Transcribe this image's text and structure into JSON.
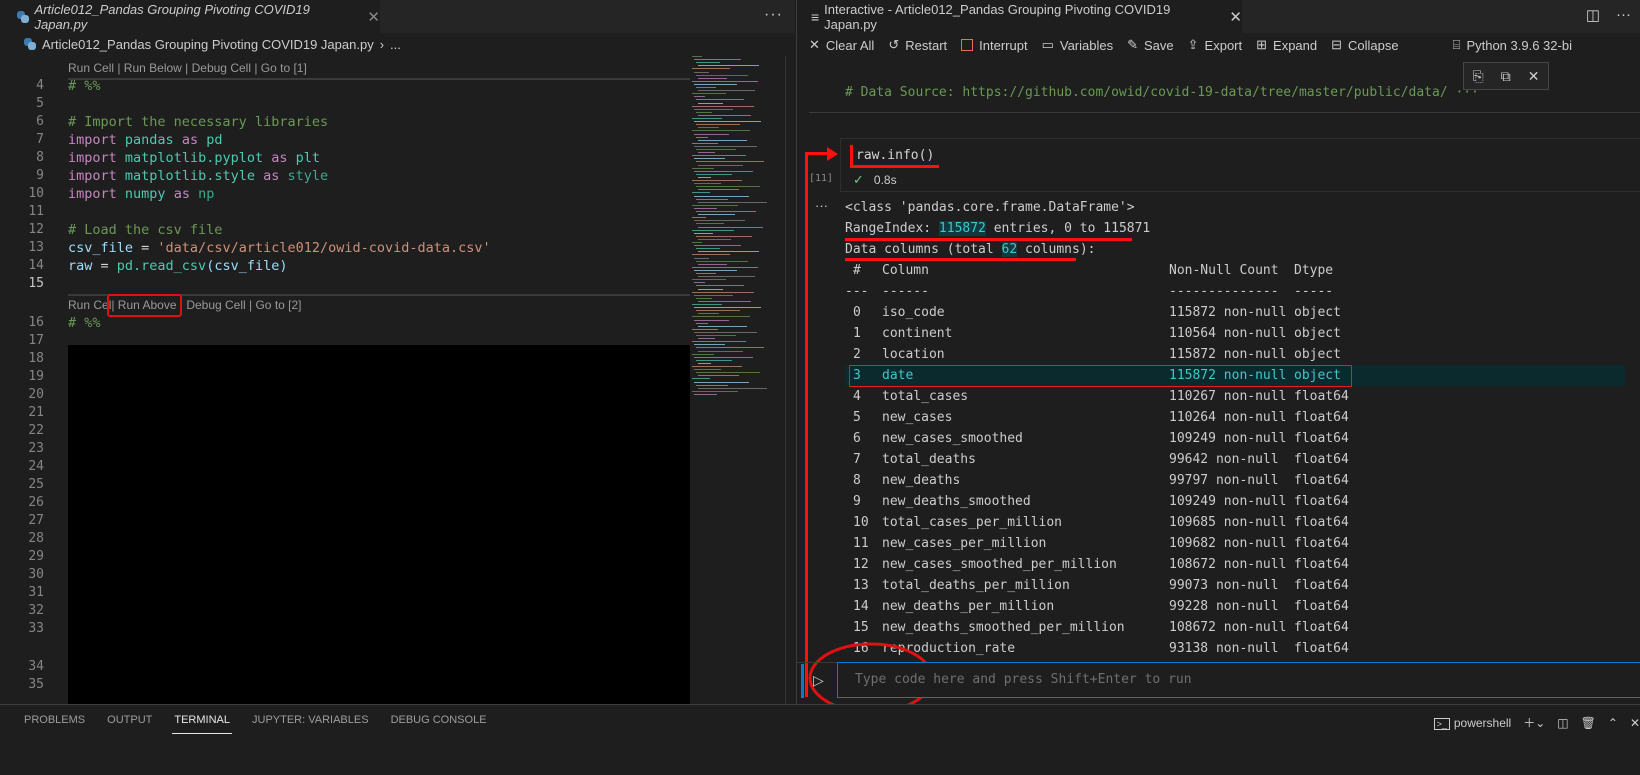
{
  "left_editor": {
    "tab_label": "Article012_Pandas Grouping Pivoting COVID19 Japan.py",
    "tab_close": "✕",
    "more": "···",
    "breadcrumb": "Article012_Pandas Grouping Pivoting COVID19 Japan.py",
    "breadcrumb_sep": "›",
    "breadcrumb_more": "...",
    "codelens_1": "Run Cell | Run Below | Debug Cell | Go to [1]",
    "codelens_2_part1": "Run Cel",
    "codelens_2_part2": "| Run Above |",
    "codelens_2_part3": " Debug Cell | Go to [2]",
    "line_numbers": [
      "4",
      "5",
      "6",
      "7",
      "8",
      "9",
      "10",
      "11",
      "12",
      "13",
      "14",
      "15",
      "16",
      "17",
      "18",
      "19",
      "20",
      "21",
      "22",
      "23",
      "24",
      "25",
      "26",
      "27",
      "28",
      "29",
      "30",
      "31",
      "32",
      "33",
      "34",
      "35"
    ],
    "code": {
      "l4": "# %%",
      "l6": "# Import the necessary libraries",
      "import": "import",
      "as": "as",
      "pandas": "pandas",
      "pd": "pd",
      "pyplot": "matplotlib.pyplot",
      "plt": "plt",
      "mstyle": "matplotlib.style",
      "style": "style",
      "numpy": "numpy",
      "np": "np",
      "l12": "# Load the csv file",
      "csv_file": "csv_file",
      "eq": " = ",
      "csv_path": "'data/csv/article012/owid-covid-data.csv'",
      "raw": "raw",
      "read_csv": "pd.read_csv",
      "read_arg": "(csv_file)",
      "l16": "# %%"
    }
  },
  "interactive": {
    "tab_label": "Interactive - Article012_Pandas Grouping Pivoting COVID19 Japan.py",
    "tab_close": "✕",
    "toolbar": [
      {
        "icon": "✕",
        "label": "Clear All"
      },
      {
        "icon": "↺",
        "label": "Restart"
      },
      {
        "icon": "interrupt",
        "label": "Interrupt"
      },
      {
        "icon": "▭",
        "label": "Variables"
      },
      {
        "icon": "✎",
        "label": "Save"
      },
      {
        "icon": "⇪",
        "label": "Export"
      },
      {
        "icon": "⊞",
        "label": "Expand"
      },
      {
        "icon": "⊟",
        "label": "Collapse"
      }
    ],
    "kernel": "Python 3.9.6 32-bi",
    "prev_cell_comment": "# Data Source: https://github.com/owid/covid-19-data/tree/master/public/data/ ···",
    "cell_code": "raw.info()",
    "exec_count": "[11]",
    "exec_time": "0.8s",
    "output": {
      "class_line": "<class 'pandas.core.frame.DataFrame'>",
      "range_prefix": "RangeIndex: ",
      "range_num": "115872",
      "range_suffix": " entries, 0 to 115871",
      "cols_prefix": "Data columns (total ",
      "cols_num": "62",
      "cols_suffix": " columns):",
      "headers": [
        "#",
        "Column",
        "Non-Null Count",
        "Dtype"
      ],
      "rules": [
        "---",
        "------",
        "--------------",
        "-----"
      ],
      "rows": [
        [
          "0",
          "iso_code",
          "115872 non-null",
          "object"
        ],
        [
          "1",
          "continent",
          "110564 non-null",
          "object"
        ],
        [
          "2",
          "location",
          "115872 non-null",
          "object"
        ],
        [
          "3",
          "date",
          "115872 non-null",
          "object"
        ],
        [
          "4",
          "total_cases",
          "110267 non-null",
          "float64"
        ],
        [
          "5",
          "new_cases",
          "110264 non-null",
          "float64"
        ],
        [
          "6",
          "new_cases_smoothed",
          "109249 non-null",
          "float64"
        ],
        [
          "7",
          "total_deaths",
          "99642 non-null",
          "float64"
        ],
        [
          "8",
          "new_deaths",
          "99797 non-null",
          "float64"
        ],
        [
          "9",
          "new_deaths_smoothed",
          "109249 non-null",
          "float64"
        ],
        [
          "10",
          "total_cases_per_million",
          "109685 non-null",
          "float64"
        ],
        [
          "11",
          "new_cases_per_million",
          "109682 non-null",
          "float64"
        ],
        [
          "12",
          "new_cases_smoothed_per_million",
          "108672 non-null",
          "float64"
        ],
        [
          "13",
          "total_deaths_per_million",
          "99073 non-null",
          "float64"
        ],
        [
          "14",
          "new_deaths_per_million",
          "99228 non-null",
          "float64"
        ],
        [
          "15",
          "new_deaths_smoothed_per_million",
          "108672 non-null",
          "float64"
        ],
        [
          "16",
          "reproduction_rate",
          "93138 non-null",
          "float64"
        ]
      ],
      "selected_row": 3
    },
    "input_placeholder": "Type code here and press Shift+Enter to run"
  },
  "panel": {
    "tabs": [
      "PROBLEMS",
      "OUTPUT",
      "TERMINAL",
      "JUPYTER: VARIABLES",
      "DEBUG CONSOLE"
    ],
    "active_tab": "TERMINAL",
    "terminal_name": "powershell"
  },
  "colors": {
    "accent": "#0a7acc",
    "annotation": "#ff1010",
    "highlight": "#3dc9c9"
  }
}
